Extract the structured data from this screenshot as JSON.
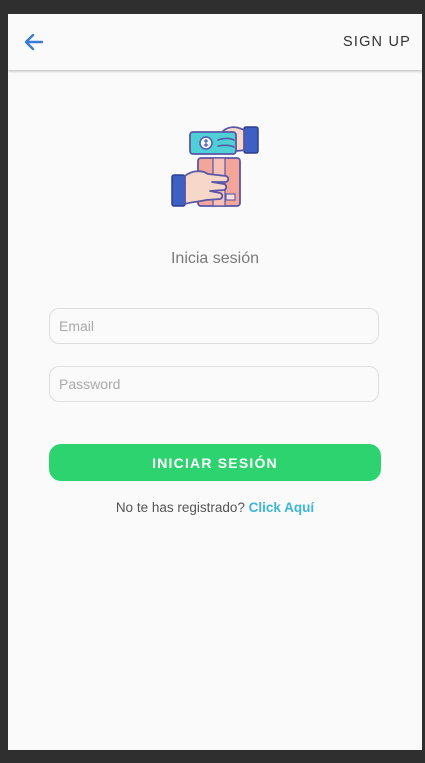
{
  "header": {
    "back_icon": "arrow-left-icon",
    "signup_label": "SIGN UP",
    "accent_color": "#3a7bd5"
  },
  "illustration": {
    "icon": "money-for-package-exchange-icon"
  },
  "login": {
    "title": "Inicia sesión",
    "email_placeholder": "Email",
    "password_placeholder": "Password",
    "submit_label": "INICIAR SESIÓN",
    "submit_color": "#2dd36f"
  },
  "register": {
    "prompt": "No te has registrado?",
    "link_label": "Click Aquí",
    "link_color": "#3bb6d8"
  }
}
